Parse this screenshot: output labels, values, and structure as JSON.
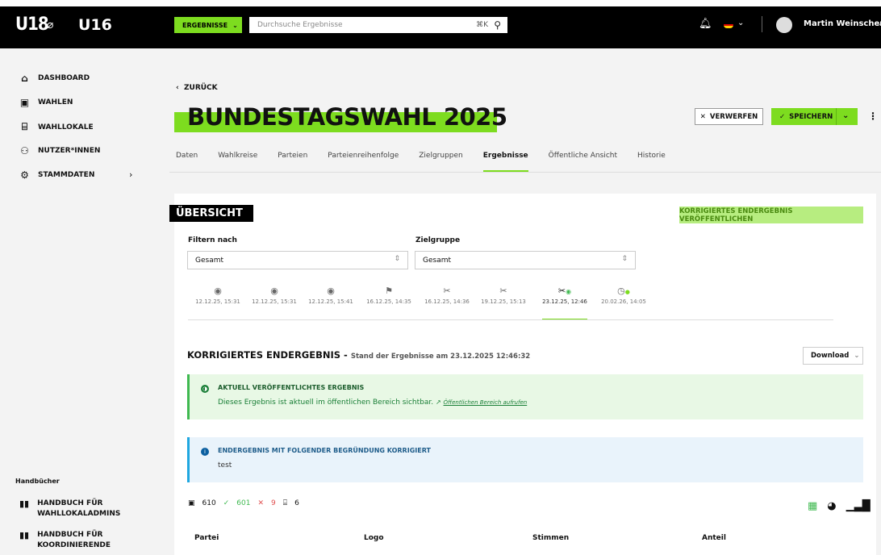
{
  "header": {
    "logo_u18": "U18",
    "logo_u16": "U16",
    "section_select": "ERGEBNISSE",
    "search_placeholder": "Durchsuche Ergebnisse",
    "search_shortcut": "⌘K",
    "user_name": "Martin Weinschenk"
  },
  "sidebar": {
    "items": [
      {
        "label": "DASHBOARD",
        "icon": "home-icon"
      },
      {
        "label": "WAHLEN",
        "icon": "ballot-icon"
      },
      {
        "label": "WAHLLOKALE",
        "icon": "building-icon"
      },
      {
        "label": "NUTZER*INNEN",
        "icon": "users-icon"
      },
      {
        "label": "STAMMDATEN",
        "icon": "gear-icon"
      }
    ],
    "handbooks_title": "Handbücher",
    "handbooks": [
      {
        "line1": "HANDBUCH FÜR",
        "line2": "WAHLLOKALADMINS"
      },
      {
        "line1": "HANDBUCH FÜR",
        "line2": "KOORDINIERENDE"
      }
    ]
  },
  "page": {
    "back": "ZURÜCK",
    "title": "BUNDESTAGSWAHL 2025",
    "discard": "VERWERFEN",
    "save": "SPEICHERN"
  },
  "tabs": [
    "Daten",
    "Wahlkreise",
    "Parteien",
    "Parteienreihenfolge",
    "Zielgruppen",
    "Ergebnisse",
    "Öffentliche Ansicht",
    "Historie"
  ],
  "overview": {
    "title": "ÜBERSICHT",
    "publish_button": "KORRIGIERTES ENDERGEBNIS VERÖFFENTLICHEN",
    "filter_label": "Filtern nach",
    "filter_value": "Gesamt",
    "target_label": "Zielgruppe",
    "target_value": "Gesamt"
  },
  "timeline": [
    {
      "date": "12.12.25, 15:31",
      "icon": "eye-icon"
    },
    {
      "date": "12.12.25, 15:31",
      "icon": "eye-icon"
    },
    {
      "date": "12.12.25, 15:41",
      "icon": "eye-icon"
    },
    {
      "date": "16.12.25, 14:35",
      "icon": "flag-icon"
    },
    {
      "date": "16.12.25, 14:36",
      "icon": "tools-icon"
    },
    {
      "date": "19.12.25, 15:13",
      "icon": "tools-icon"
    },
    {
      "date": "23.12.25, 12:46",
      "icon": "tools-published-icon"
    },
    {
      "date": "20.02.26, 14:05",
      "icon": "clock-icon"
    }
  ],
  "result": {
    "title": "KORRIGIERTES ENDERGEBNIS -",
    "subtitle": "Stand der Ergebnisse am 23.12.2025 12:46:32",
    "download": "Download"
  },
  "alerts": {
    "published_head": "AKTUELL VERÖFFENTLICHTES ERGEBNIS",
    "published_body": "Dieses Ergebnis ist aktuell im öffentlichen Bereich sichtbar.",
    "published_link": "Öffentlichen Bereich aufrufen",
    "corrected_head": "ENDERGEBNIS MIT FOLGENDER BEGRÜNDUNG KORRIGIERT",
    "corrected_body": "test"
  },
  "stats": {
    "ballots": "610",
    "valid": "601",
    "invalid": "9",
    "locations": "6"
  },
  "table": {
    "headers": [
      "Partei",
      "Logo",
      "Stimmen",
      "Anteil"
    ]
  },
  "colors": {
    "accent": "#7ddc1f",
    "success": "#3fb950",
    "info": "#1fa7e0"
  }
}
